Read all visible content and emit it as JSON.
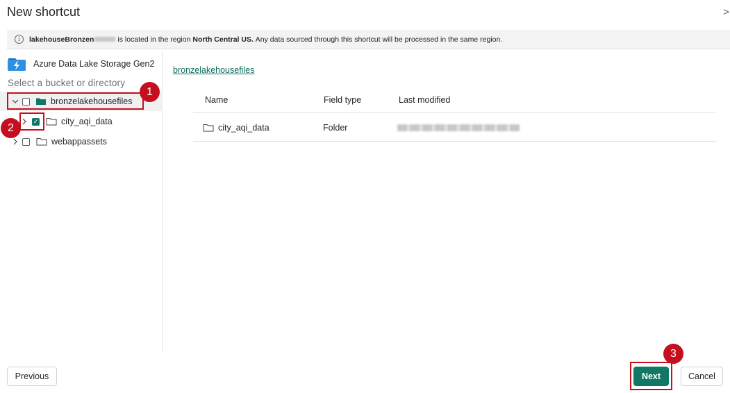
{
  "dialog": {
    "title": "New shortcut",
    "close_glyph": ">"
  },
  "info_bar": {
    "icon": "info-icon",
    "lakehouse_name": "lakehouseBronzen",
    "text_middle": "is located in the region",
    "region": "North Central US.",
    "text_end": "Any data sourced through this shortcut will be processed in the same region."
  },
  "source": {
    "icon": "azure-data-lake-icon",
    "label": "Azure Data Lake Storage Gen2"
  },
  "tree": {
    "heading": "Select a bucket or directory",
    "items": [
      {
        "label": "bronzelakehousefiles",
        "expanded": true,
        "checked": false,
        "selected": true
      },
      {
        "label": "city_aqi_data",
        "expanded": false,
        "checked": true,
        "selected": false
      },
      {
        "label": "webappassets",
        "expanded": false,
        "checked": false,
        "selected": false
      }
    ]
  },
  "content": {
    "breadcrumb": "bronzelakehousefiles",
    "columns": [
      "Name",
      "Field type",
      "Last modified"
    ],
    "rows": [
      {
        "name": "city_aqi_data",
        "type": "Folder"
      }
    ]
  },
  "annotations": [
    "1",
    "2",
    "3"
  ],
  "footer": {
    "previous_label": "Previous",
    "next_label": "Next",
    "cancel_label": "Cancel"
  },
  "colors": {
    "accent": "#117865",
    "annotation": "#c50f1f",
    "link": "#0f6b5c"
  }
}
